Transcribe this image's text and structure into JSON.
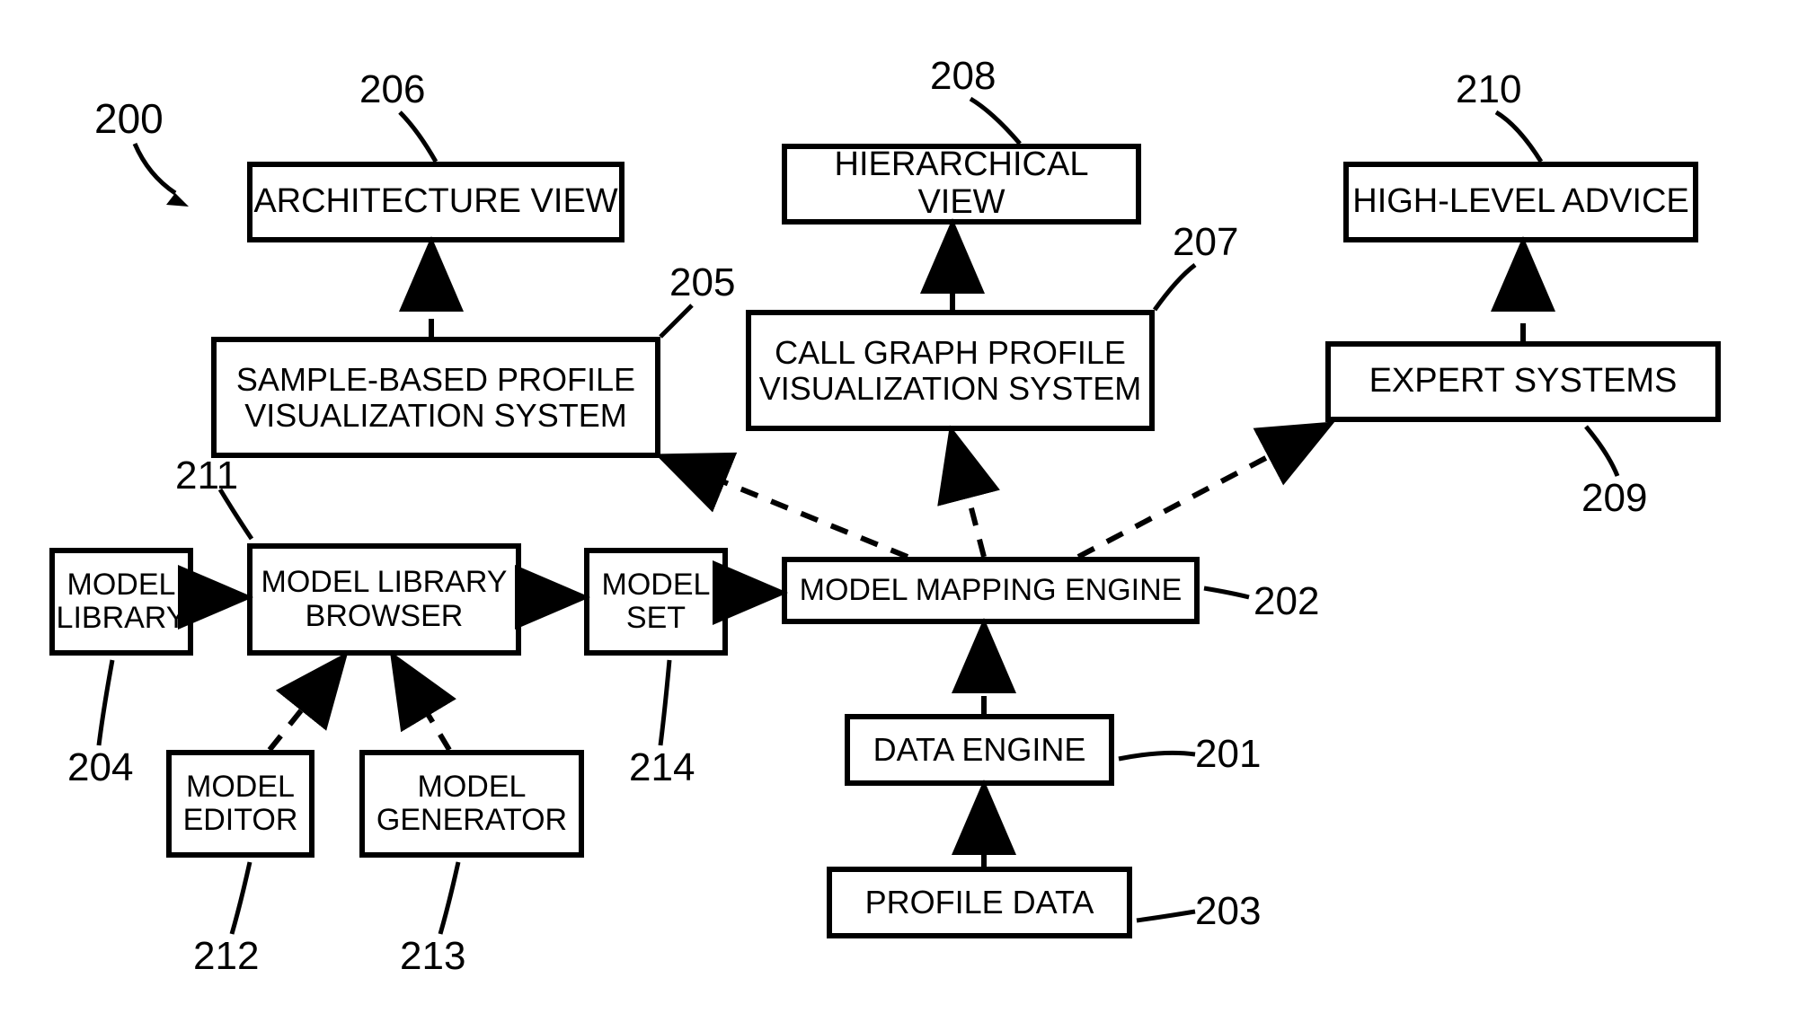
{
  "figure_ref": "200",
  "boxes": {
    "architecture_view": {
      "text": "ARCHITECTURE VIEW",
      "ref": "206"
    },
    "hierarchical_view": {
      "text": "HIERARCHICAL VIEW",
      "ref": "208"
    },
    "high_level_advice": {
      "text": "HIGH-LEVEL ADVICE",
      "ref": "210"
    },
    "sample_vis": {
      "text": "SAMPLE-BASED PROFILE\nVISUALIZATION SYSTEM",
      "ref": "205"
    },
    "callgraph_vis": {
      "text": "CALL GRAPH PROFILE\nVISUALIZATION SYSTEM",
      "ref": "207"
    },
    "expert_systems": {
      "text": "EXPERT SYSTEMS",
      "ref": "209"
    },
    "model_library": {
      "text": "MODEL\nLIBRARY",
      "ref": "204"
    },
    "model_lib_browser": {
      "text": "MODEL LIBRARY\nBROWSER",
      "ref": "211"
    },
    "model_set": {
      "text": "MODEL\nSET",
      "ref": "214"
    },
    "model_mapping_engine": {
      "text": "MODEL MAPPING ENGINE",
      "ref": "202"
    },
    "model_editor": {
      "text": "MODEL\nEDITOR",
      "ref": "212"
    },
    "model_generator": {
      "text": "MODEL\nGENERATOR",
      "ref": "213"
    },
    "data_engine": {
      "text": "DATA ENGINE",
      "ref": "201"
    },
    "profile_data": {
      "text": "PROFILE DATA",
      "ref": "203"
    }
  }
}
